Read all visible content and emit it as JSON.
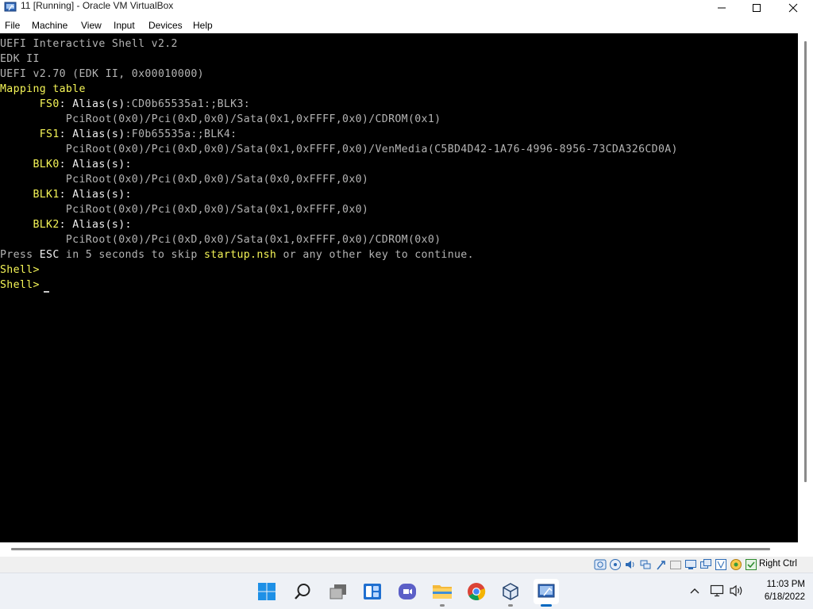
{
  "window": {
    "title": "11 [Running] - Oracle VM VirtualBox"
  },
  "menubar": {
    "items": [
      "File",
      "Machine",
      "View",
      "Input",
      "Devices",
      "Help"
    ]
  },
  "console": {
    "lines": [
      [
        {
          "t": "UEFI Interactive Shell v2.2",
          "c": "g"
        }
      ],
      [
        {
          "t": "EDK II",
          "c": "g"
        }
      ],
      [
        {
          "t": "UEFI v2.70 (EDK II, 0x00010000)",
          "c": "g"
        }
      ],
      [
        {
          "t": "Mapping table",
          "c": "y"
        }
      ],
      [
        {
          "t": "      FS0",
          "c": "y"
        },
        {
          "t": ": Alias(s)",
          "c": "w"
        },
        {
          "t": ":CD0b65535a1:;BLK3:",
          "c": "g"
        }
      ],
      [
        {
          "t": "          PciRoot(0x0)/Pci(0xD,0x0)/Sata(0x1,0xFFFF,0x0)/CDROM(0x1)",
          "c": "g"
        }
      ],
      [
        {
          "t": "      FS1",
          "c": "y"
        },
        {
          "t": ": Alias(s)",
          "c": "w"
        },
        {
          "t": ":F0b65535a:;BLK4:",
          "c": "g"
        }
      ],
      [
        {
          "t": "          PciRoot(0x0)/Pci(0xD,0x0)/Sata(0x1,0xFFFF,0x0)/VenMedia(C5BD4D42-1A76-4996-8956-73CDA326CD0A)",
          "c": "g"
        }
      ],
      [
        {
          "t": "     BLK0",
          "c": "y"
        },
        {
          "t": ": Alias(s):",
          "c": "w"
        }
      ],
      [
        {
          "t": "          PciRoot(0x0)/Pci(0xD,0x0)/Sata(0x0,0xFFFF,0x0)",
          "c": "g"
        }
      ],
      [
        {
          "t": "     BLK1",
          "c": "y"
        },
        {
          "t": ": Alias(s):",
          "c": "w"
        }
      ],
      [
        {
          "t": "          PciRoot(0x0)/Pci(0xD,0x0)/Sata(0x1,0xFFFF,0x0)",
          "c": "g"
        }
      ],
      [
        {
          "t": "     BLK2",
          "c": "y"
        },
        {
          "t": ": Alias(s):",
          "c": "w"
        }
      ],
      [
        {
          "t": "          PciRoot(0x0)/Pci(0xD,0x0)/Sata(0x1,0xFFFF,0x0)/CDROM(0x0)",
          "c": "g"
        }
      ],
      [
        {
          "t": "Press ",
          "c": "g"
        },
        {
          "t": "ESC",
          "c": "w"
        },
        {
          "t": " in 5 seconds to skip ",
          "c": "g"
        },
        {
          "t": "startup.nsh",
          "c": "y"
        },
        {
          "t": " or any other key to continue.",
          "c": "g"
        }
      ],
      [
        {
          "t": "Shell>",
          "c": "y"
        }
      ],
      [
        {
          "t": "Shell> ",
          "c": "y"
        }
      ]
    ]
  },
  "statusbar": {
    "host_key": "Right Ctrl"
  },
  "tray": {
    "time": "11:03 PM",
    "date": "6/18/2022"
  },
  "colors": {
    "console_bg": "#000000",
    "console_yellow": "#f5f557",
    "console_white": "#f0f0f0",
    "console_gray": "#b4b4b4",
    "accent": "#0067c0"
  }
}
